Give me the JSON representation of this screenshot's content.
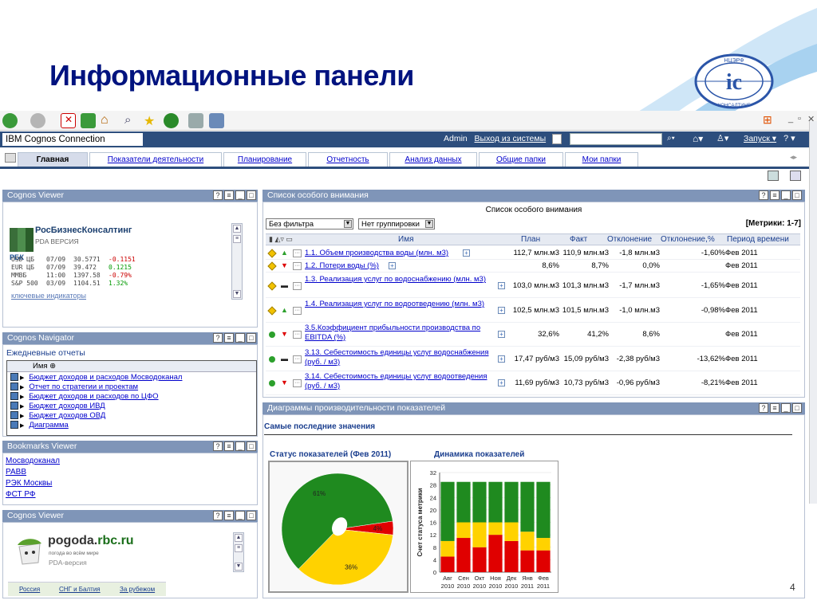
{
  "slide": {
    "title": "Информационные панели",
    "page_number": "4"
  },
  "logo": {
    "text_top": "НЦЭРФ",
    "text_bottom": "КОНСАЛТИНГ"
  },
  "header": {
    "brand": "IBM Cognos Connection",
    "user": "Admin",
    "logout": "Выход из системы",
    "launch": "Запуск"
  },
  "tabs": [
    {
      "label": "Главная"
    },
    {
      "label": "Показатели деятельности"
    },
    {
      "label": "Планирование"
    },
    {
      "label": "Отчетность"
    },
    {
      "label": "Анализ данных"
    },
    {
      "label": "Общие папки"
    },
    {
      "label": "Мои папки"
    }
  ],
  "viewer1": {
    "title": "Cognos Viewer",
    "rbc_title": "РосБизнесКонсалтинг",
    "rbc_sub": "PDA ВЕРСИЯ",
    "rbc_logo": "РБК",
    "quotes": [
      {
        "name": "USD ЦБ",
        "date": "07/09",
        "value": "30.5771",
        "change": "-0.1151",
        "color": "#cc0000"
      },
      {
        "name": "EUR ЦБ",
        "date": "07/09",
        "value": "39.472",
        "change": "0.1215",
        "color": "#009900"
      },
      {
        "name": "ММВБ",
        "date": "11:00",
        "value": "1397.58",
        "change": "-0.79%",
        "color": "#cc0000"
      },
      {
        "name": "S&P 500",
        "date": "03/09",
        "value": "1104.51",
        "change": "1.32%",
        "color": "#009900"
      }
    ],
    "link": "ключевые индикаторы"
  },
  "navigator": {
    "title": "Cognos Navigator",
    "subtitle": "Ежедневные отчеты",
    "column": "Имя",
    "items": [
      "Бюджет доходов и расходов Мосводоканал",
      "Отчет по стратегии и проектам",
      "Бюджет доходов и расходов по ЦФО",
      "Бюджет доходов ИВД",
      "Бюджет доходов ОВД",
      "Диаграмма"
    ]
  },
  "bookmarks": {
    "title": "Bookmarks Viewer",
    "items": [
      "Мосводоканал",
      "РАВВ",
      "РЭК Москвы",
      "ФСТ РФ"
    ]
  },
  "viewer2": {
    "title": "Cognos Viewer",
    "brand_main": "pogoda.",
    "brand_rest": "rbc.ru",
    "tagline": "погода во всём мире",
    "pda": "PDA-версия",
    "links": [
      "Россия",
      "СНГ и Балтия",
      "За рубежом"
    ]
  },
  "watchlist": {
    "title": "Список особого внимания",
    "heading": "Список особого внимания",
    "filter": "Без фильтра",
    "grouping": "Нет группировки",
    "metrics_count": "[Метрики: 1-7]",
    "columns": [
      "Имя",
      "План",
      "Факт",
      "Отклонение",
      "Отклонение,%",
      "Период времени"
    ],
    "rows": [
      {
        "status": "#f2c200",
        "trend": "up",
        "name": "1.1. Объем производства воды (млн. м3)",
        "plan": "112,7 млн.м3",
        "fact": "110,9 млн.м3",
        "dev": "-1,8 млн.м3",
        "devp": "-1,60%",
        "period": "Фев 2011"
      },
      {
        "status": "#f2c200",
        "trend": "down",
        "name": "1.2. Потери воды (%)",
        "plan": "8,6%",
        "fact": "8,7%",
        "dev": "0,0%",
        "devp": "",
        "period": "Фев 2011"
      },
      {
        "status": "#f2c200",
        "trend": "flat",
        "name": "1.3. Реализация услуг по водоснабжению (млн. м3)",
        "plan": "103,0 млн.м3",
        "fact": "101,3 млн.м3",
        "dev": "-1,7 млн.м3",
        "devp": "-1,65%",
        "period": "Фев 2011"
      },
      {
        "status": "#f2c200",
        "trend": "up",
        "name": "1.4. Реализация услуг по водоотведению (млн. м3)",
        "plan": "102,5 млн.м3",
        "fact": "101,5 млн.м3",
        "dev": "-1,0 млн.м3",
        "devp": "-0,98%",
        "period": "Фев 2011"
      },
      {
        "status": "#2ca02c",
        "trend": "down",
        "name": "3.5.Коэффициент прибыльности производства по EBITDA (%)",
        "plan": "32,6%",
        "fact": "41,2%",
        "dev": "8,6%",
        "devp": "",
        "period": "Фев 2011"
      },
      {
        "status": "#2ca02c",
        "trend": "flat",
        "name": "3.13. Себестоимость единицы услуг водоснабжения (руб. / м3)",
        "plan": "17,47 руб/м3",
        "fact": "15,09 руб/м3",
        "dev": "-2,38 руб/м3",
        "devp": "-13,62%",
        "period": "Фев 2011"
      },
      {
        "status": "#2ca02c",
        "trend": "down",
        "name": "3.14. Себестоимость единицы услуг водоотведения (руб. / м3)",
        "plan": "11,69 руб/м3",
        "fact": "10,73 руб/м3",
        "dev": "-0,96 руб/м3",
        "devp": "-8,21%",
        "period": "Фев 2011"
      }
    ]
  },
  "charts_portlet": {
    "title": "Диаграммы производительности показателей",
    "subtitle": "Самые последние значения"
  },
  "chart_data": [
    {
      "type": "pie",
      "title": "Статус показателей (Фев 2011)",
      "categories": [
        "green",
        "yellow",
        "red"
      ],
      "values": [
        61,
        36,
        4
      ],
      "labels": [
        "61%",
        "36%",
        "4%"
      ],
      "colors": [
        "#1f8a1f",
        "#ffd200",
        "#e00000"
      ]
    },
    {
      "type": "bar",
      "title": "Динамика показателей",
      "ylabel": "Счет статуса метрики",
      "categories": [
        "Авг 2010",
        "Сен 2010",
        "Окт 2010",
        "Ноя 2010",
        "Дек 2010",
        "Янв 2011",
        "Фев 2011"
      ],
      "yticks": [
        "0",
        "4",
        "8",
        "12",
        "16",
        "20",
        "24",
        "28",
        "32"
      ],
      "ylim": [
        0,
        32
      ],
      "series": [
        {
          "color": "#e00000",
          "values": [
            5,
            11,
            8,
            12,
            10,
            7,
            7
          ]
        },
        {
          "color": "#ffd200",
          "values": [
            5,
            5,
            8,
            4,
            6,
            6,
            4
          ]
        },
        {
          "color": "#1f8a1f",
          "values": [
            19,
            13,
            13,
            13,
            13,
            16,
            18
          ]
        }
      ]
    }
  ]
}
